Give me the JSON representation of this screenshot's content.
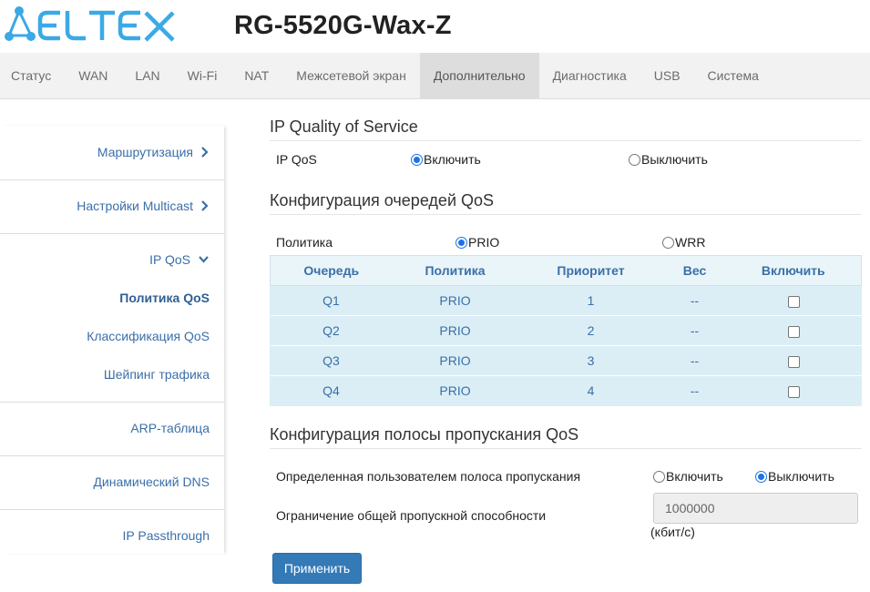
{
  "header": {
    "brand": "ELTEX",
    "model": "RG-5520G-Wax-Z"
  },
  "topnav": {
    "tabs": [
      {
        "label": "Статус"
      },
      {
        "label": "WAN"
      },
      {
        "label": "LAN"
      },
      {
        "label": "Wi-Fi"
      },
      {
        "label": "NAT"
      },
      {
        "label": "Межсетевой экран"
      },
      {
        "label": "Дополнительно"
      },
      {
        "label": "Диагностика"
      },
      {
        "label": "USB"
      },
      {
        "label": "Система"
      }
    ],
    "active": "Дополнительно"
  },
  "sidebar": {
    "routing": "Маршрутизация",
    "multicast": "Настройки Multicast",
    "ipqos": "IP QoS",
    "qos_policy": "Политика QoS",
    "qos_class": "Классификация QoS",
    "shaping": "Шейпинг трафика",
    "arp": "ARP-таблица",
    "ddns": "Динамический DNS",
    "passthrough": "IP Passthrough"
  },
  "ipqos": {
    "title": "IP Quality of Service",
    "label": "IP QoS",
    "enable": "Включить",
    "disable": "Выключить",
    "selected": "enable"
  },
  "queue_config": {
    "title": "Конфигурация очередей QoS",
    "policy_label": "Политика",
    "prio": "PRIO",
    "wrr": "WRR",
    "selected": "PRIO",
    "columns": [
      "Очередь",
      "Политика",
      "Приоритет",
      "Вес",
      "Включить"
    ],
    "rows": [
      {
        "queue": "Q1",
        "policy": "PRIO",
        "priority": "1",
        "weight": "--",
        "enabled": false
      },
      {
        "queue": "Q2",
        "policy": "PRIO",
        "priority": "2",
        "weight": "--",
        "enabled": false
      },
      {
        "queue": "Q3",
        "policy": "PRIO",
        "priority": "3",
        "weight": "--",
        "enabled": false
      },
      {
        "queue": "Q4",
        "policy": "PRIO",
        "priority": "4",
        "weight": "--",
        "enabled": false
      }
    ]
  },
  "bandwidth": {
    "title": "Конфигурация полосы пропускания QoS",
    "user_defined_label": "Определенная пользователем полоса пропускания",
    "enable": "Включить",
    "disable": "Выключить",
    "selected": "disable",
    "limit_label": "Ограничение общей пропускной способности",
    "limit_value": "1000000",
    "unit": "(кбит/с)"
  },
  "apply_label": "Применить",
  "colors": {
    "accent": "#3a6fa8",
    "brand": "#3ba9e6",
    "button": "#337ab7",
    "table_bg": "#dbeef5"
  }
}
